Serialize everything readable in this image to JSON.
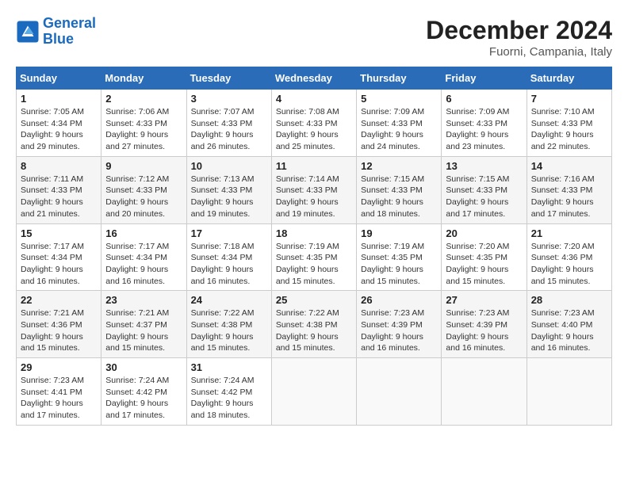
{
  "header": {
    "logo_line1": "General",
    "logo_line2": "Blue",
    "month_year": "December 2024",
    "location": "Fuorni, Campania, Italy"
  },
  "weekdays": [
    "Sunday",
    "Monday",
    "Tuesday",
    "Wednesday",
    "Thursday",
    "Friday",
    "Saturday"
  ],
  "weeks": [
    [
      {
        "day": "1",
        "sunrise": "7:05 AM",
        "sunset": "4:34 PM",
        "daylight": "9 hours and 29 minutes."
      },
      {
        "day": "2",
        "sunrise": "7:06 AM",
        "sunset": "4:33 PM",
        "daylight": "9 hours and 27 minutes."
      },
      {
        "day": "3",
        "sunrise": "7:07 AM",
        "sunset": "4:33 PM",
        "daylight": "9 hours and 26 minutes."
      },
      {
        "day": "4",
        "sunrise": "7:08 AM",
        "sunset": "4:33 PM",
        "daylight": "9 hours and 25 minutes."
      },
      {
        "day": "5",
        "sunrise": "7:09 AM",
        "sunset": "4:33 PM",
        "daylight": "9 hours and 24 minutes."
      },
      {
        "day": "6",
        "sunrise": "7:09 AM",
        "sunset": "4:33 PM",
        "daylight": "9 hours and 23 minutes."
      },
      {
        "day": "7",
        "sunrise": "7:10 AM",
        "sunset": "4:33 PM",
        "daylight": "9 hours and 22 minutes."
      }
    ],
    [
      {
        "day": "8",
        "sunrise": "7:11 AM",
        "sunset": "4:33 PM",
        "daylight": "9 hours and 21 minutes."
      },
      {
        "day": "9",
        "sunrise": "7:12 AM",
        "sunset": "4:33 PM",
        "daylight": "9 hours and 20 minutes."
      },
      {
        "day": "10",
        "sunrise": "7:13 AM",
        "sunset": "4:33 PM",
        "daylight": "9 hours and 19 minutes."
      },
      {
        "day": "11",
        "sunrise": "7:14 AM",
        "sunset": "4:33 PM",
        "daylight": "9 hours and 19 minutes."
      },
      {
        "day": "12",
        "sunrise": "7:15 AM",
        "sunset": "4:33 PM",
        "daylight": "9 hours and 18 minutes."
      },
      {
        "day": "13",
        "sunrise": "7:15 AM",
        "sunset": "4:33 PM",
        "daylight": "9 hours and 17 minutes."
      },
      {
        "day": "14",
        "sunrise": "7:16 AM",
        "sunset": "4:33 PM",
        "daylight": "9 hours and 17 minutes."
      }
    ],
    [
      {
        "day": "15",
        "sunrise": "7:17 AM",
        "sunset": "4:34 PM",
        "daylight": "9 hours and 16 minutes."
      },
      {
        "day": "16",
        "sunrise": "7:17 AM",
        "sunset": "4:34 PM",
        "daylight": "9 hours and 16 minutes."
      },
      {
        "day": "17",
        "sunrise": "7:18 AM",
        "sunset": "4:34 PM",
        "daylight": "9 hours and 16 minutes."
      },
      {
        "day": "18",
        "sunrise": "7:19 AM",
        "sunset": "4:35 PM",
        "daylight": "9 hours and 15 minutes."
      },
      {
        "day": "19",
        "sunrise": "7:19 AM",
        "sunset": "4:35 PM",
        "daylight": "9 hours and 15 minutes."
      },
      {
        "day": "20",
        "sunrise": "7:20 AM",
        "sunset": "4:35 PM",
        "daylight": "9 hours and 15 minutes."
      },
      {
        "day": "21",
        "sunrise": "7:20 AM",
        "sunset": "4:36 PM",
        "daylight": "9 hours and 15 minutes."
      }
    ],
    [
      {
        "day": "22",
        "sunrise": "7:21 AM",
        "sunset": "4:36 PM",
        "daylight": "9 hours and 15 minutes."
      },
      {
        "day": "23",
        "sunrise": "7:21 AM",
        "sunset": "4:37 PM",
        "daylight": "9 hours and 15 minutes."
      },
      {
        "day": "24",
        "sunrise": "7:22 AM",
        "sunset": "4:38 PM",
        "daylight": "9 hours and 15 minutes."
      },
      {
        "day": "25",
        "sunrise": "7:22 AM",
        "sunset": "4:38 PM",
        "daylight": "9 hours and 15 minutes."
      },
      {
        "day": "26",
        "sunrise": "7:23 AM",
        "sunset": "4:39 PM",
        "daylight": "9 hours and 16 minutes."
      },
      {
        "day": "27",
        "sunrise": "7:23 AM",
        "sunset": "4:39 PM",
        "daylight": "9 hours and 16 minutes."
      },
      {
        "day": "28",
        "sunrise": "7:23 AM",
        "sunset": "4:40 PM",
        "daylight": "9 hours and 16 minutes."
      }
    ],
    [
      {
        "day": "29",
        "sunrise": "7:23 AM",
        "sunset": "4:41 PM",
        "daylight": "9 hours and 17 minutes."
      },
      {
        "day": "30",
        "sunrise": "7:24 AM",
        "sunset": "4:42 PM",
        "daylight": "9 hours and 17 minutes."
      },
      {
        "day": "31",
        "sunrise": "7:24 AM",
        "sunset": "4:42 PM",
        "daylight": "9 hours and 18 minutes."
      },
      null,
      null,
      null,
      null
    ]
  ],
  "labels": {
    "sunrise": "Sunrise: ",
    "sunset": "Sunset: ",
    "daylight": "Daylight: "
  }
}
